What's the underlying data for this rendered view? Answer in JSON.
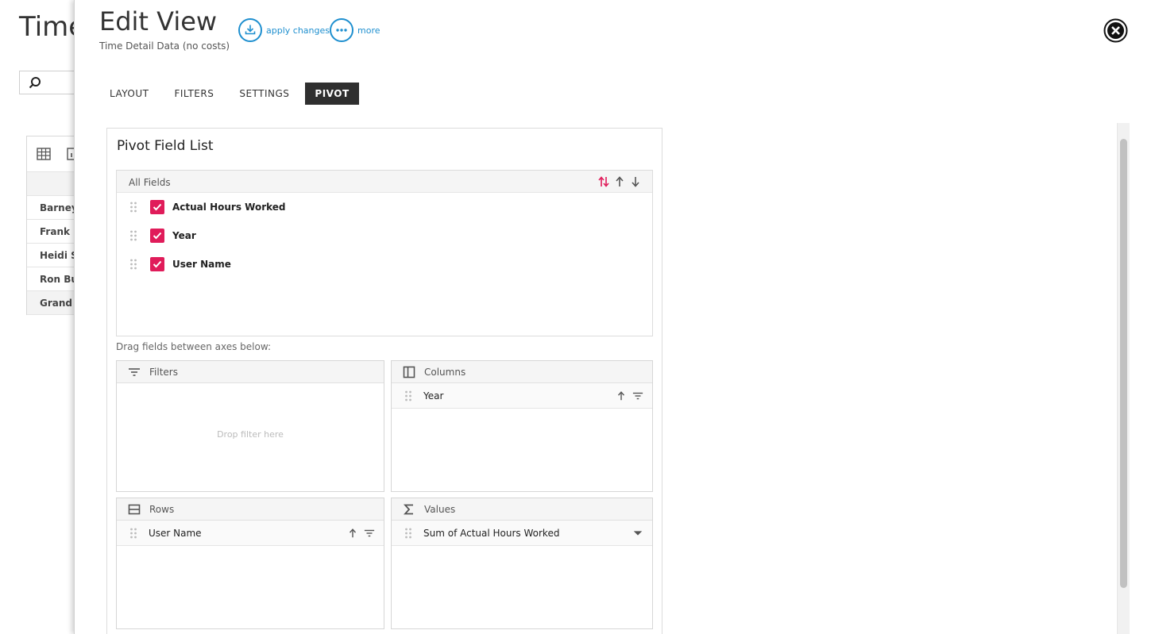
{
  "background": {
    "title": "Time",
    "rows": [
      "Barney",
      "Frank R",
      "Heidi St",
      "Ron Bur",
      "Grand T"
    ]
  },
  "panel": {
    "title": "Edit View",
    "subtitle": "Time Detail Data (no costs)",
    "actions": {
      "apply": "apply changes",
      "more": "more"
    },
    "tabs": [
      {
        "label": "LAYOUT",
        "active": false
      },
      {
        "label": "FILTERS",
        "active": false
      },
      {
        "label": "SETTINGS",
        "active": false
      },
      {
        "label": "PIVOT",
        "active": true
      }
    ]
  },
  "pivot": {
    "title": "Pivot Field List",
    "all_fields_label": "All Fields",
    "fields": [
      {
        "name": "Actual Hours Worked",
        "checked": true
      },
      {
        "name": "Year",
        "checked": true
      },
      {
        "name": "User Name",
        "checked": true
      }
    ],
    "drag_hint": "Drag fields between axes below:",
    "areas": {
      "filters": {
        "label": "Filters",
        "empty_hint": "Drop filter here"
      },
      "columns": {
        "label": "Columns",
        "items": [
          "Year"
        ]
      },
      "rows": {
        "label": "Rows",
        "items": [
          "User Name"
        ]
      },
      "values": {
        "label": "Values",
        "items": [
          "Sum of Actual Hours Worked"
        ]
      }
    }
  },
  "colors": {
    "accent": "#1e8fcf",
    "checkbox": "#e01c5a",
    "active_tab": "#2f2f2f"
  }
}
